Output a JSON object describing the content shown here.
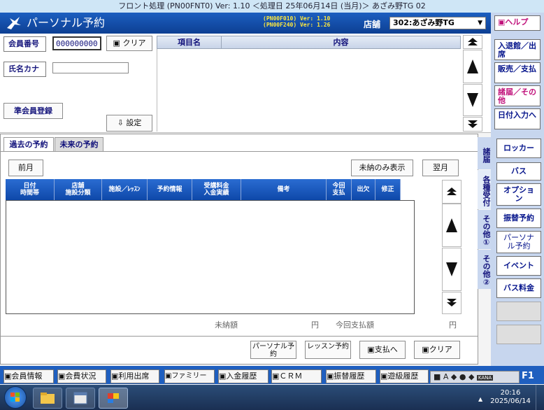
{
  "window": {
    "title": "フロント処理 (PN00FNT0) Ver: 1.10 ＜処理日 25年06月14日 (当月)＞ あざみ野TG 02"
  },
  "header": {
    "app_title": "パーソナル予約",
    "version_line1": "(PN00F010) Ver: 1.10",
    "version_line2": "(PN00F240) Ver: 1.26",
    "shop_label": "店舗",
    "shop_value": "302:あざみ野TG"
  },
  "right_top": {
    "help": "ヘルプ",
    "entry": "入退館／出席",
    "sales": "販売／支払",
    "notice": "諸届／その他",
    "date_input": "日付入力へ"
  },
  "member": {
    "no_label": "会員番号",
    "no_value": "000000000",
    "clear_label": "クリア",
    "kana_label": "氏名カナ",
    "kana_value": "",
    "associate_label": "準会員登録",
    "setting_label": "設定"
  },
  "info_table": {
    "col1": "項目名",
    "col2": "内容"
  },
  "tabs": {
    "past": "過去の予約",
    "future": "未来の予約"
  },
  "reservation": {
    "prev_month": "前月",
    "unpaid_only": "未納のみ表示",
    "next_month": "翌月",
    "columns": [
      "日付\n時間帯",
      "店舗\n施設分類",
      "施設／ﾚｯｽﾝ",
      "予約情報",
      "受講料金\n入金実績",
      "備考",
      "今回\n支払",
      "出欠",
      "修正"
    ],
    "unpaid_label": "未納額",
    "unpaid_unit": "円",
    "payment_label": "今回支払額",
    "payment_unit": "円"
  },
  "vertical_tabs": [
    "諸届",
    "各種受付",
    "その他①",
    "その他②"
  ],
  "side_buttons": [
    "ロッカー",
    "バス",
    "オプション",
    "振替予約",
    "パーソナル予約",
    "イベント",
    "バス料金"
  ],
  "actions": {
    "personal": "パーソナル予約",
    "lesson": "レッスン予約",
    "pay": "支払へ",
    "clear": "クリア"
  },
  "bottom_buttons": [
    "会員情報",
    "会費状況",
    "利用出席",
    "ファミリー",
    "入金履歴",
    "ＣＲＭ",
    "振替履歴",
    "遊級履歴"
  ],
  "taskbar": {
    "time": "20:16",
    "date": "2025/06/14",
    "ime": "KANA",
    "f1": "F1"
  }
}
